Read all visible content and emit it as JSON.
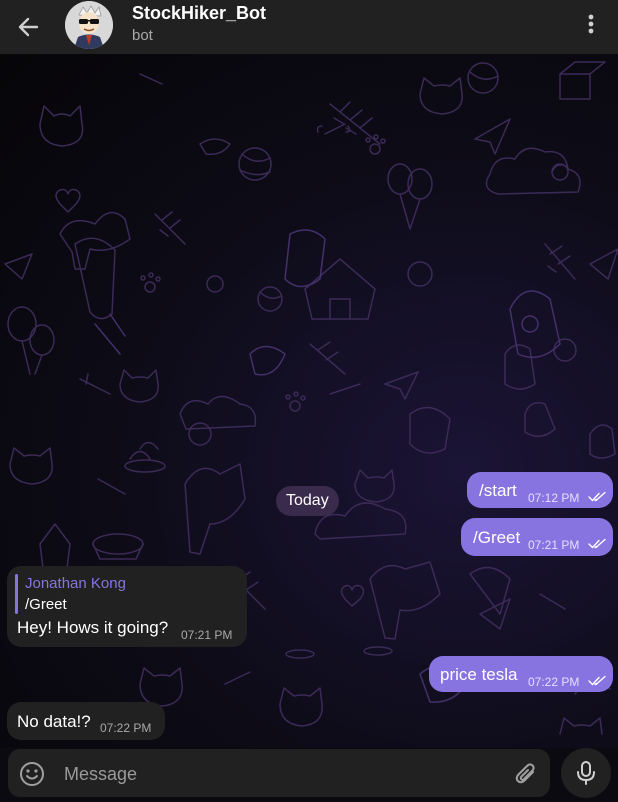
{
  "header": {
    "title": "StockHiker_Bot",
    "subtitle": "bot",
    "back_icon": "arrow-left-icon",
    "menu_icon": "more-vertical-icon"
  },
  "date_separator": "Today",
  "messages": [
    {
      "direction": "out",
      "text": "/start",
      "time": "07:12 PM",
      "status": "read"
    },
    {
      "direction": "out",
      "text": "/Greet",
      "time": "07:21 PM",
      "status": "read"
    },
    {
      "direction": "in",
      "reply_to": {
        "name": "Jonathan Kong",
        "text": "/Greet"
      },
      "text": "Hey! Hows it going?",
      "time": "07:21 PM"
    },
    {
      "direction": "out",
      "text": "price tesla",
      "time": "07:22 PM",
      "status": "read"
    },
    {
      "direction": "in",
      "text": "No data!?",
      "time": "07:22 PM"
    }
  ],
  "composer": {
    "placeholder": "Message",
    "emoji_icon": "emoji-icon",
    "attach_icon": "paperclip-icon",
    "mic_icon": "microphone-icon"
  },
  "colors": {
    "header_bg": "#212121",
    "outgoing_bubble": "#8774e1",
    "incoming_bubble": "#212121",
    "accent": "#8774e1",
    "date_pill": "#3a2a4c"
  }
}
